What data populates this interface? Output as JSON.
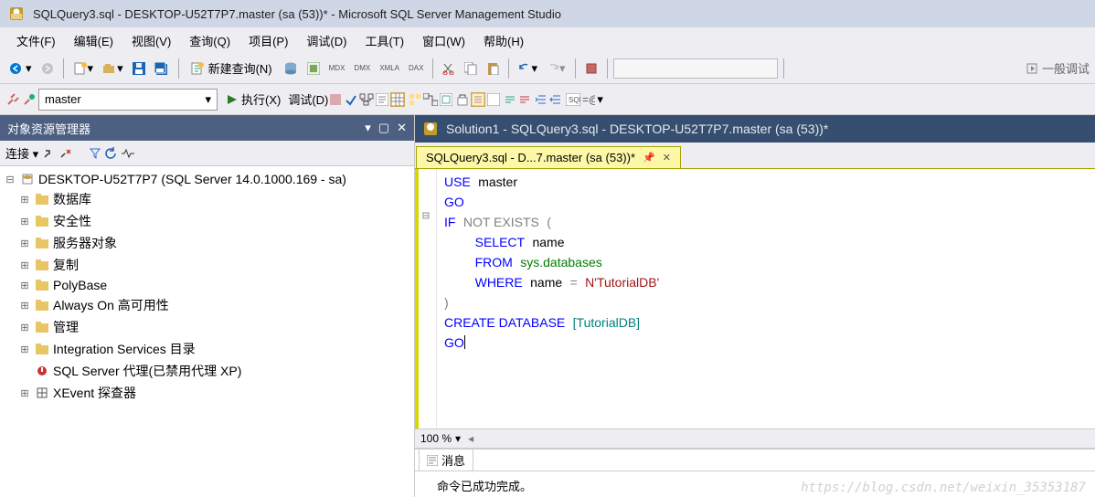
{
  "titlebar": {
    "title": "SQLQuery3.sql - DESKTOP-U52T7P7.master (sa (53))* - Microsoft SQL Server Management Studio"
  },
  "menu": [
    "文件(F)",
    "编辑(E)",
    "视图(V)",
    "查询(Q)",
    "项目(P)",
    "调试(D)",
    "工具(T)",
    "窗口(W)",
    "帮助(H)"
  ],
  "toolbar": {
    "newquery": "新建查询(N)",
    "execute": "执行(X)",
    "debug": "调试(D)",
    "database": "master",
    "right_label": "一般调试"
  },
  "explorer": {
    "title": "对象资源管理器",
    "connect": "连接",
    "root": "DESKTOP-U52T7P7 (SQL Server 14.0.1000.169 - sa)",
    "items": [
      "数据库",
      "安全性",
      "服务器对象",
      "复制",
      "PolyBase",
      "Always On 高可用性",
      "管理",
      "Integration Services 目录",
      "SQL Server 代理(已禁用代理 XP)",
      "XEvent 探查器"
    ]
  },
  "document": {
    "header": "Solution1 - SQLQuery3.sql - DESKTOP-U52T7P7.master (sa (53))*",
    "tab": "SQLQuery3.sql - D...7.master (sa (53))*",
    "zoom": "100 %"
  },
  "sql": {
    "use": "USE",
    "master": "master",
    "go": "GO",
    "if": "IF",
    "not_exists": "NOT EXISTS",
    "select": "SELECT",
    "name": "name",
    "from": "FROM",
    "sysdb": "sys.databases",
    "where": "WHERE",
    "eq": "=",
    "nstr": "N'TutorialDB'",
    "create_db": "CREATE DATABASE",
    "tutdb": "[TutorialDB]"
  },
  "messages": {
    "tab": "消息",
    "body": "命令已成功完成。"
  },
  "watermark": "https://blog.csdn.net/weixin_35353187"
}
